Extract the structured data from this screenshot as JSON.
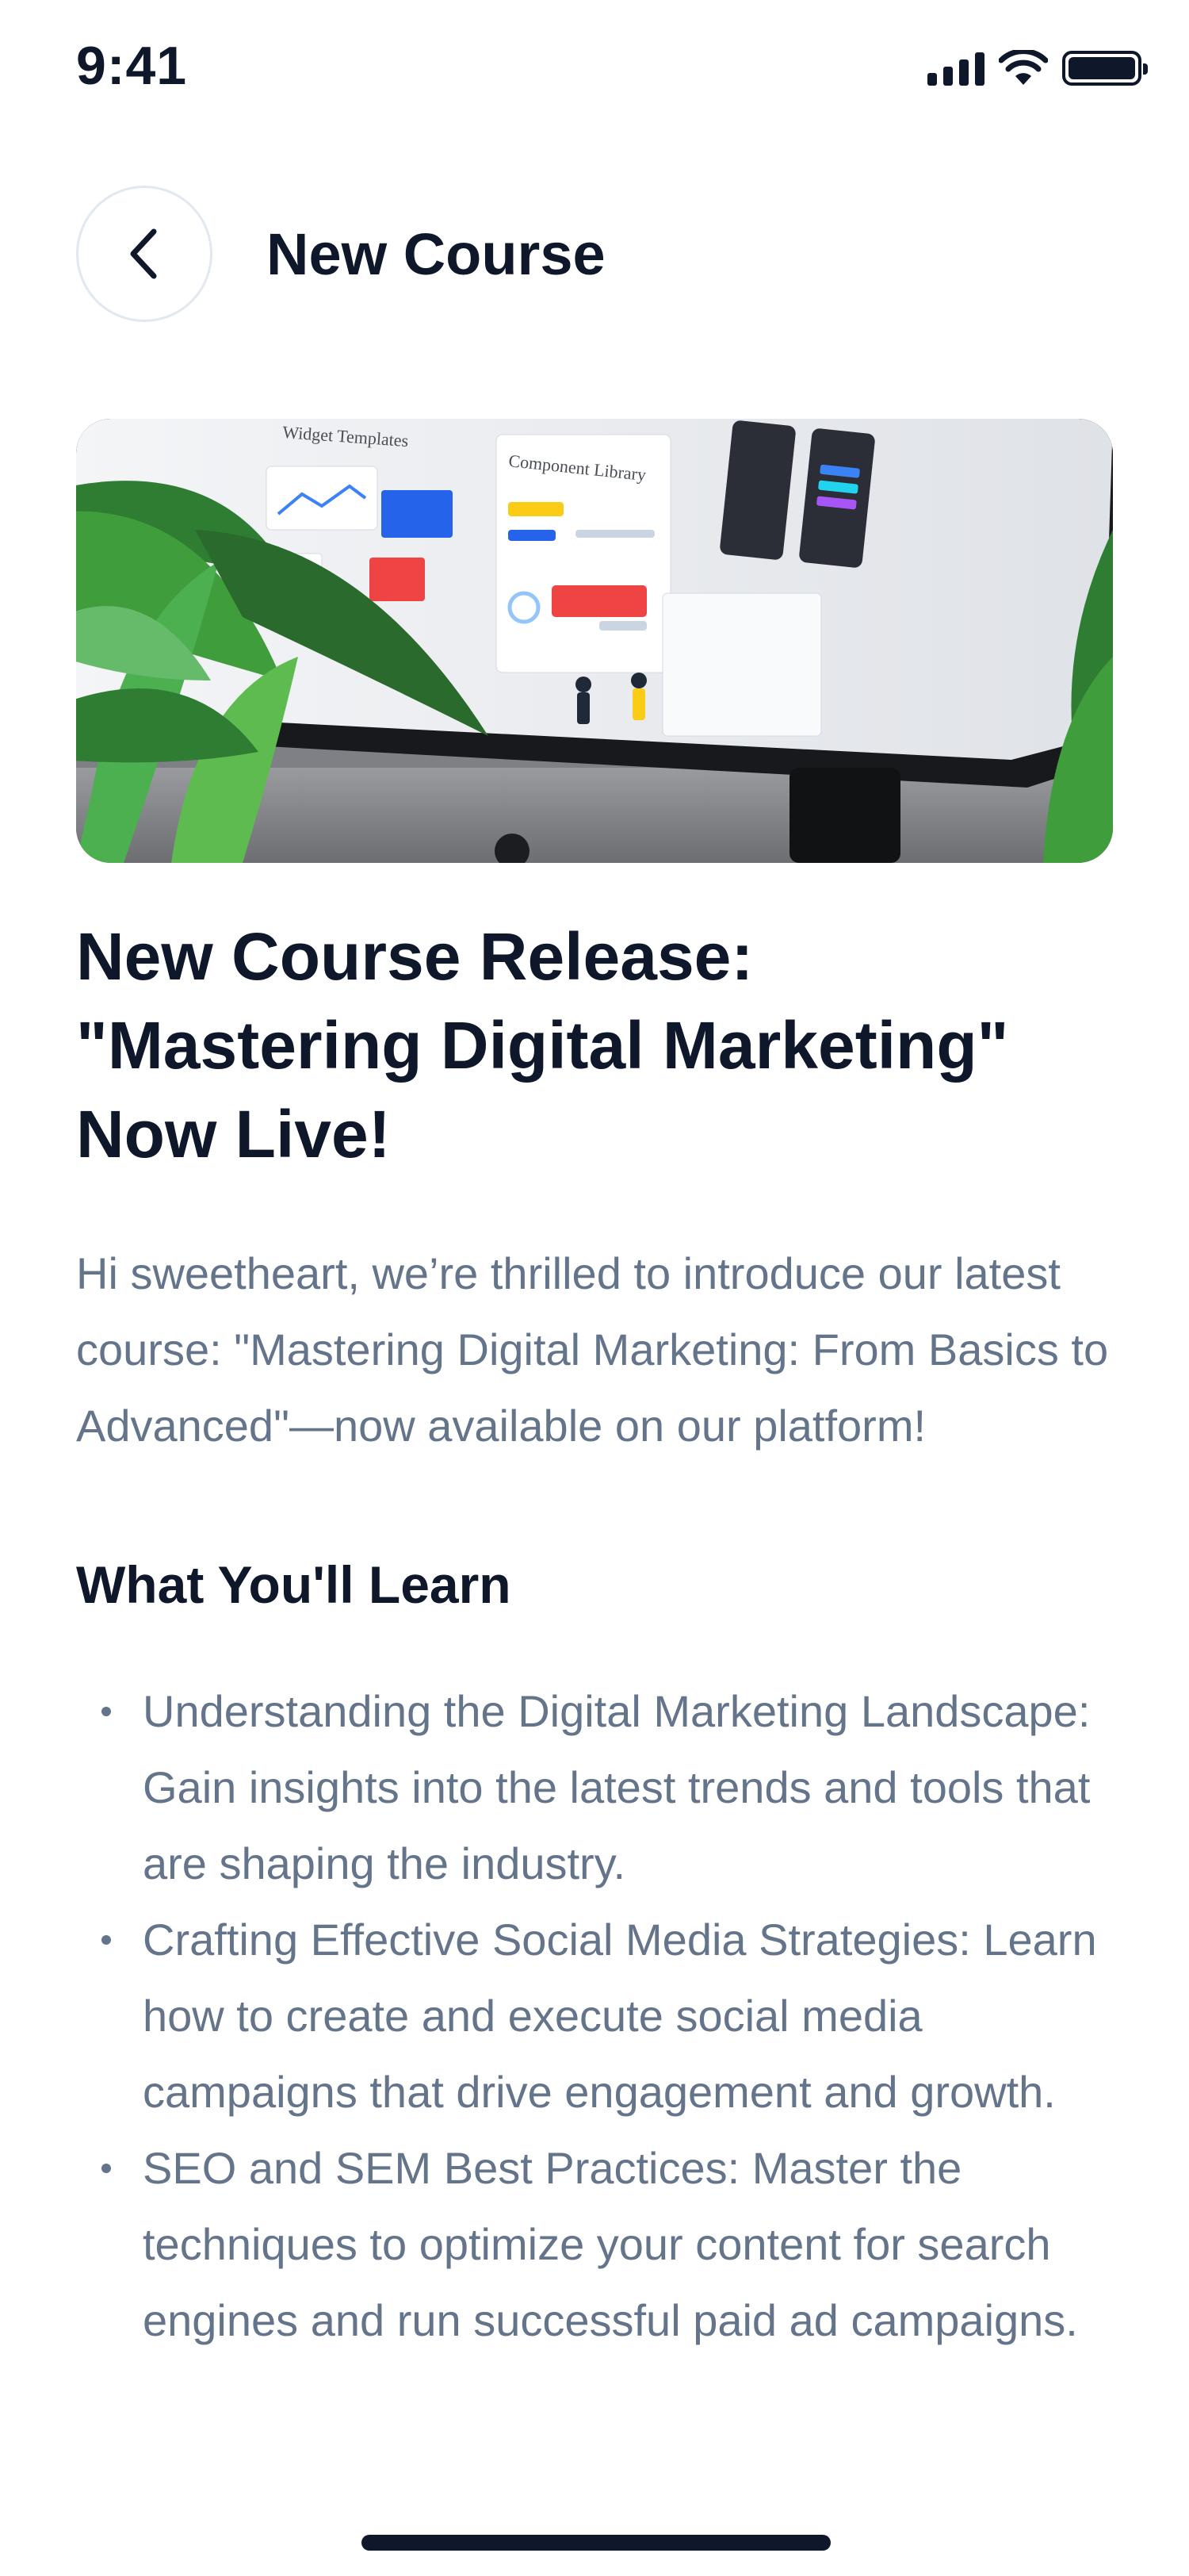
{
  "status_bar": {
    "time": "9:41"
  },
  "header": {
    "title": "New Course"
  },
  "article": {
    "title": "New Course Release: \"Mastering Digital Marketing\" Now Live!",
    "intro": "Hi sweetheart, we’re thrilled to introduce our latest course: \"Mastering Digital Marketing: From Basics to Advanced\"—now available on our platform!",
    "section_title": "What You'll Learn",
    "bullets": [
      "Understanding the Digital Marketing Landscape: Gain insights into the latest trends and tools that are shaping the industry.",
      "Crafting Effective Social Media Strategies: Learn how to create and execute social media campaigns that drive engagement and growth.",
      "SEO and SEM Best Practices: Master the techniques to optimize your content for search engines and run successful paid ad campaigns."
    ]
  },
  "hero_image": {
    "screen_labels": [
      "Widget Templates",
      "Component Library"
    ]
  },
  "colors": {
    "heading": "#0f172a",
    "body_text": "#64748b",
    "border": "#e2e8f0"
  }
}
